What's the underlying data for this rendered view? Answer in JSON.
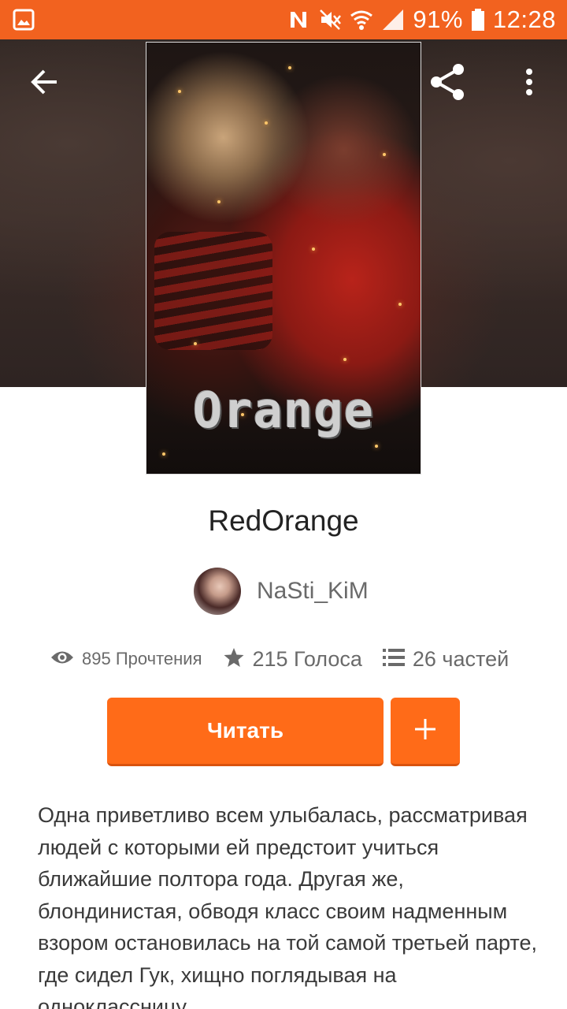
{
  "status_bar": {
    "battery": "91%",
    "time": "12:28",
    "icons": [
      "image-notification-icon",
      "n-icon",
      "mute-icon",
      "wifi-icon",
      "signal-icon",
      "battery-icon"
    ]
  },
  "header": {
    "back_icon": "arrow-left-icon",
    "share_icon": "share-icon",
    "menu_icon": "more-vert-icon"
  },
  "cover": {
    "text": "Orange"
  },
  "story": {
    "title": "RedOrange",
    "author": "NaSti_KiM",
    "reads": "895 Прочтения",
    "votes": "215 Голоса",
    "parts": "26 частей",
    "description": "Одна приветливо всем улыбалась, рассматривая людей с которыми ей предстоит учиться ближайшие полтора года. Другая же, блондинистая, обводя класс своим надменным взором остановилась на той самой третьей парте, где сидел Гук, хищно поглядывая на одноклассницу."
  },
  "actions": {
    "read_label": "Читать",
    "add_label": "+"
  },
  "colors": {
    "accent": "#ff6b18",
    "status_bar": "#f2621f"
  }
}
